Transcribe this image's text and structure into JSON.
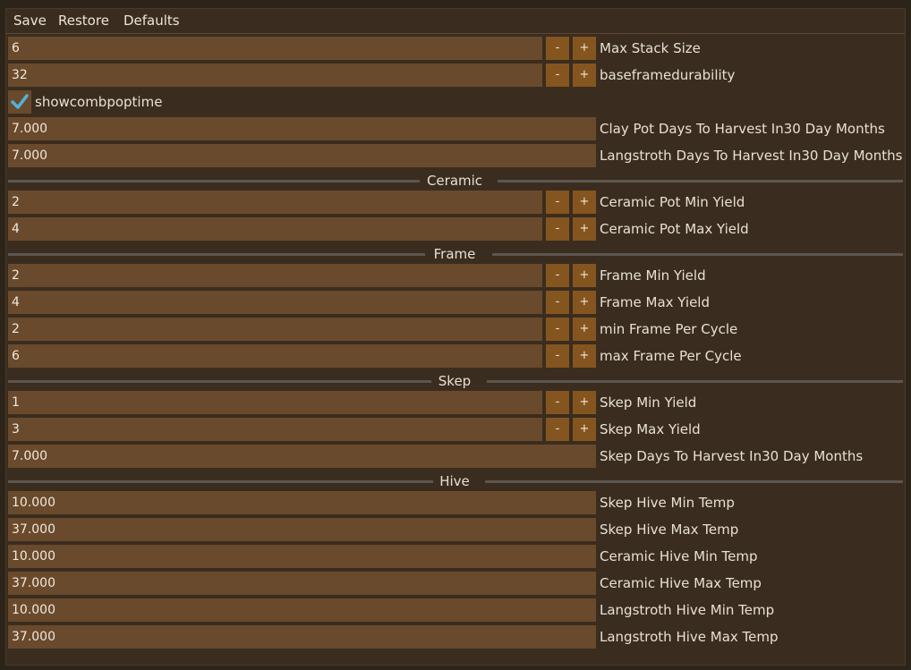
{
  "menu": {
    "save": "Save",
    "restore": "Restore",
    "defaults": "Defaults"
  },
  "stepper": {
    "minus": "-",
    "plus": "+"
  },
  "colors": {
    "field": "#6a4a2c",
    "button": "#85551f",
    "check": "#4fb3d8"
  },
  "rows": {
    "max_stack_size": {
      "value": "6",
      "label": "Max Stack Size"
    },
    "baseframedurability": {
      "value": "32",
      "label": "baseframedurability"
    },
    "showcombpoptime": {
      "label": "showcombpoptime",
      "checked": true
    },
    "clay_pot_days": {
      "value": "7.000",
      "label": "Clay Pot Days To Harvest In30 Day Months"
    },
    "langstroth_days": {
      "value": "7.000",
      "label": "Langstroth Days To Harvest In30 Day Months"
    },
    "ceramic_pot_min": {
      "value": "2",
      "label": "Ceramic Pot Min Yield"
    },
    "ceramic_pot_max": {
      "value": "4",
      "label": "Ceramic Pot Max Yield"
    },
    "frame_min": {
      "value": "2",
      "label": "Frame Min Yield"
    },
    "frame_max": {
      "value": "4",
      "label": "Frame Max Yield"
    },
    "min_frame_cycle": {
      "value": "2",
      "label": "min Frame Per Cycle"
    },
    "max_frame_cycle": {
      "value": "6",
      "label": "max Frame Per Cycle"
    },
    "skep_min": {
      "value": "1",
      "label": "Skep Min Yield"
    },
    "skep_max": {
      "value": "3",
      "label": "Skep Max Yield"
    },
    "skep_days": {
      "value": "7.000",
      "label": "Skep Days To Harvest In30 Day Months"
    },
    "skep_hive_min_temp": {
      "value": "10.000",
      "label": "Skep Hive Min Temp"
    },
    "skep_hive_max_temp": {
      "value": "37.000",
      "label": "Skep Hive Max Temp"
    },
    "ceramic_hive_min_temp": {
      "value": "10.000",
      "label": "Ceramic Hive Min Temp"
    },
    "ceramic_hive_max_temp": {
      "value": "37.000",
      "label": "Ceramic Hive Max Temp"
    },
    "langstroth_hive_min_temp": {
      "value": "10.000",
      "label": "Langstroth Hive Min Temp"
    },
    "langstroth_hive_max_temp": {
      "value": "37.000",
      "label": "Langstroth Hive Max Temp"
    }
  },
  "sections": {
    "ceramic": "Ceramic",
    "frame": "Frame",
    "skep": "Skep",
    "hive": "Hive"
  }
}
